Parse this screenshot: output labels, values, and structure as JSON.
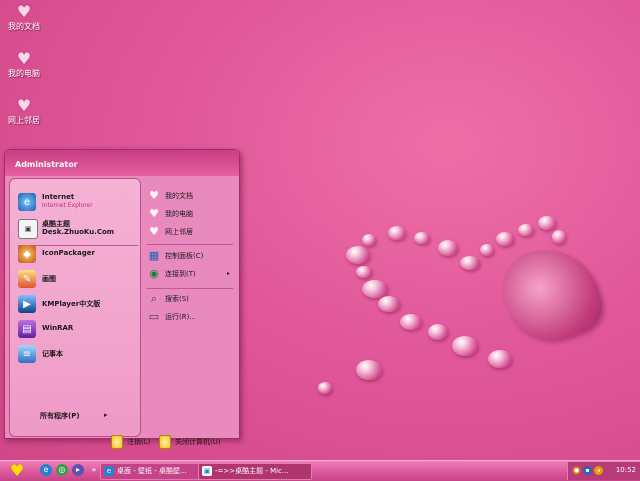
{
  "desktop": {
    "icons": [
      {
        "label": "我的文档",
        "icon": "heart-icon"
      },
      {
        "label": "我的电脑",
        "icon": "heart-icon"
      },
      {
        "label": "网上邻居",
        "icon": "heart-icon"
      }
    ]
  },
  "start_menu": {
    "user": "Administrator",
    "pinned": [
      {
        "title": "Internet",
        "subtitle": "Internet Explorer",
        "icon": "ie-icon"
      },
      {
        "title": "桌酷主题",
        "subtitle": "Desk.ZhuoKu.Com",
        "icon": "zhuoku-icon"
      }
    ],
    "recent": [
      {
        "title": "IconPackager",
        "icon": "iconpackager-icon"
      },
      {
        "title": "画图",
        "icon": "paint-icon"
      },
      {
        "title": "KMPlayer中文版",
        "icon": "kmplayer-icon"
      },
      {
        "title": "WinRAR",
        "icon": "winrar-icon"
      },
      {
        "title": "记事本",
        "icon": "notepad-icon"
      }
    ],
    "all_programs": "所有程序(P)",
    "right": [
      {
        "label": "我的文档",
        "icon": "heart-icon"
      },
      {
        "label": "我的电脑",
        "icon": "heart-icon"
      },
      {
        "label": "网上邻居",
        "icon": "heart-icon"
      },
      {
        "label": "控制面板(C)",
        "icon": "control-panel-icon"
      },
      {
        "label": "连接到(T)",
        "icon": "connect-icon"
      },
      {
        "label": "搜索(S)",
        "icon": "search-icon"
      },
      {
        "label": "运行(R)...",
        "icon": "run-icon"
      }
    ],
    "logoff": "注销(L)",
    "shutdown": "关闭计算机(U)"
  },
  "taskbar": {
    "tasks": [
      {
        "label": "桌面 - 壁纸 - 桌酷壁...",
        "icon": "browser-icon"
      },
      {
        "label": "-=>>桌酷主题 - Mic...",
        "icon": "window-icon"
      }
    ],
    "clock": "10:52"
  },
  "colors": {
    "wallpaper": "#e0579a",
    "menu_bg": "#e98abf",
    "taskbar": "#d9559a",
    "start_button": "#ffe000"
  }
}
